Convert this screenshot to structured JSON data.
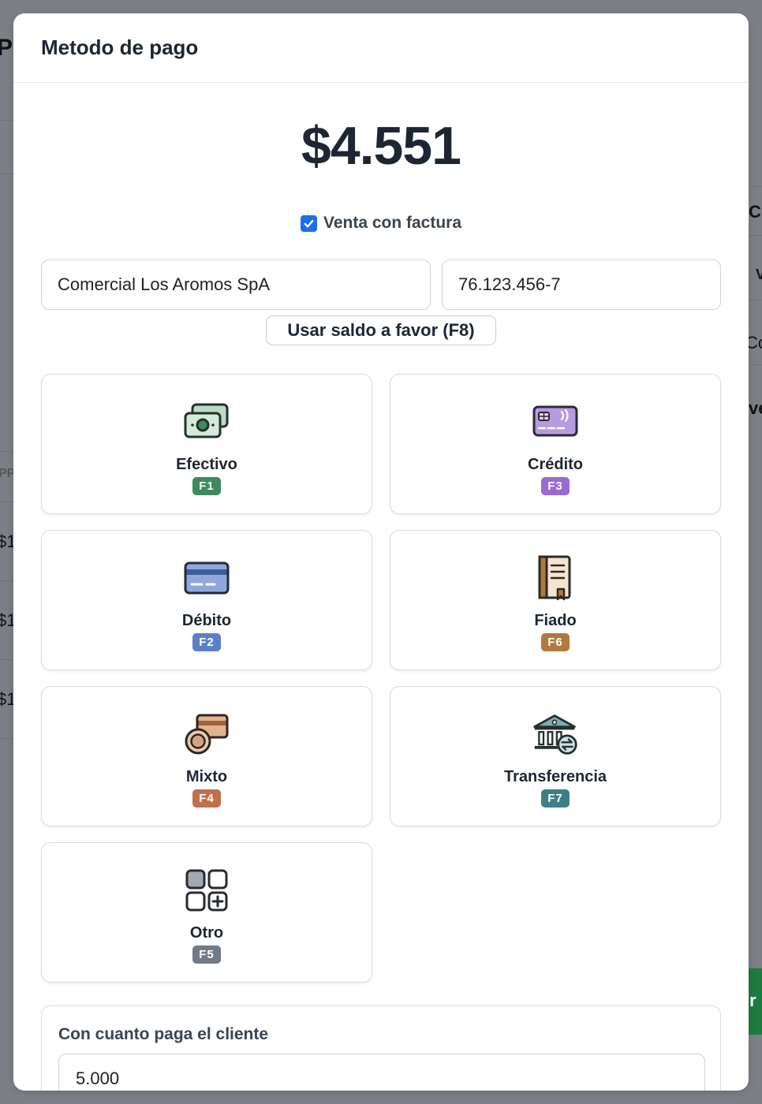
{
  "modal": {
    "title": "Metodo de pago",
    "total": "$4.551",
    "invoice_checkbox": {
      "label": "Venta con factura",
      "checked": true
    },
    "customer_name": "Comercial Los Aromos SpA",
    "customer_rut": "76.123.456-7",
    "use_credit_button": "Usar saldo a favor (F8)",
    "payment_methods": [
      {
        "label": "Efectivo",
        "key": "F1",
        "icon": "cash-icon",
        "color": "#3d8b5c"
      },
      {
        "label": "Crédito",
        "key": "F3",
        "icon": "credit-card-contactless-icon",
        "color": "#9a6ad1"
      },
      {
        "label": "Débito",
        "key": "F2",
        "icon": "debit-card-icon",
        "color": "#5b7fc9"
      },
      {
        "label": "Fiado",
        "key": "F6",
        "icon": "ledger-book-icon",
        "color": "#b07a3e"
      },
      {
        "label": "Mixto",
        "key": "F4",
        "icon": "coin-and-card-icon",
        "color": "#c0714a"
      },
      {
        "label": "Transferencia",
        "key": "F7",
        "icon": "bank-transfer-icon",
        "color": "#3f7f84"
      },
      {
        "label": "Otro",
        "key": "F5",
        "icon": "grid-plus-icon",
        "color": "#717a87"
      }
    ],
    "payment_amount": {
      "label": "Con cuanto paga el cliente",
      "value": "5.000"
    }
  },
  "background": {
    "fragments": [
      "P",
      "C",
      "V",
      "Co",
      "ve",
      "PP",
      "$1",
      "$1",
      "$1",
      "r"
    ]
  }
}
